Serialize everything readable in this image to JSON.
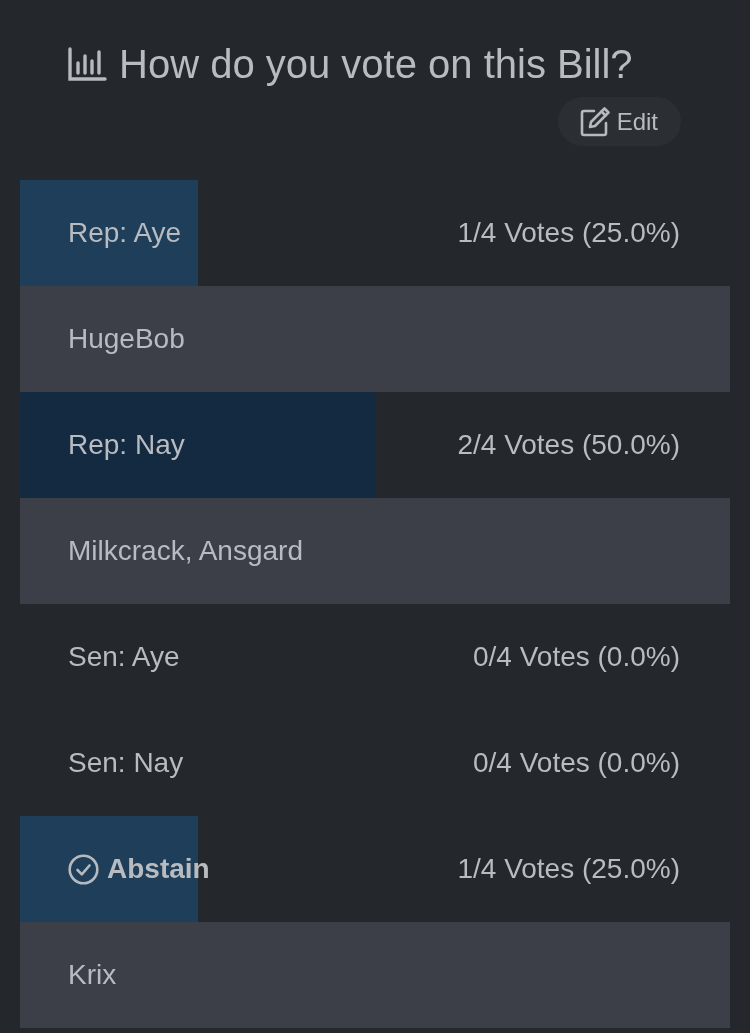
{
  "title": "How do you vote on this Bill?",
  "edit_button": "Edit",
  "options": [
    {
      "label": "Rep: Aye",
      "votes": "1/4 Votes (25.0%)",
      "level": 0.25,
      "color": "#1e3e59",
      "selected": false,
      "voters": "HugeBob"
    },
    {
      "label": "Rep: Nay",
      "votes": "2/4 Votes (50.0%)",
      "level": 0.5,
      "color": "#142a40",
      "selected": false,
      "voters": "Milkcrack, Ansgard"
    },
    {
      "label": "Sen: Aye",
      "votes": "0/4 Votes (0.0%)",
      "selected": false
    },
    {
      "label": "Sen: Nay",
      "votes": "0/4 Votes (0.0%)",
      "selected": false
    },
    {
      "label": "Abstain",
      "votes": "1/4 Votes (25.0%)",
      "level": 0.25,
      "color": "#1e3e59",
      "selected": true,
      "voters": "Krix"
    }
  ]
}
